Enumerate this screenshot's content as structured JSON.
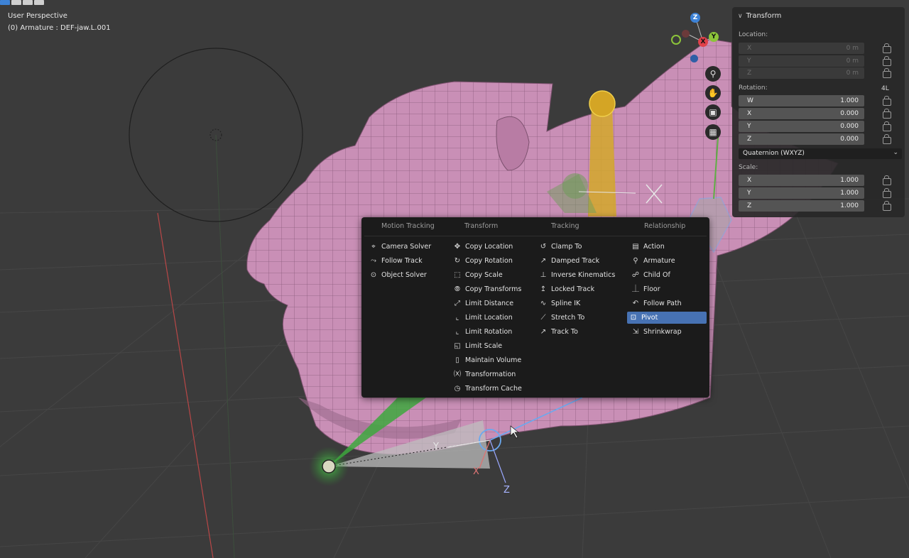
{
  "viewport": {
    "mode_label": "User Perspective",
    "object_label": "(0) Armature : DEF-jaw.L.001",
    "gizmo_axes": {
      "x": "X",
      "y": "Y",
      "z": "Z"
    },
    "bone_axis_labels": {
      "x": "X",
      "y": "Y",
      "z": "Z"
    },
    "nav_tools": [
      "zoom-icon",
      "pan-hand-icon",
      "camera-icon",
      "grid-icon"
    ]
  },
  "transform_panel": {
    "title": "Transform",
    "location_label": "Location:",
    "location": [
      {
        "axis": "X",
        "value": "0 m"
      },
      {
        "axis": "Y",
        "value": "0 m"
      },
      {
        "axis": "Z",
        "value": "0 m"
      }
    ],
    "rotation_label": "Rotation:",
    "rotation_badge": "4L",
    "rotation": [
      {
        "axis": "W",
        "value": "1.000"
      },
      {
        "axis": "X",
        "value": "0.000"
      },
      {
        "axis": "Y",
        "value": "0.000"
      },
      {
        "axis": "Z",
        "value": "0.000"
      }
    ],
    "rotation_mode": "Quaternion (WXYZ)",
    "scale_label": "Scale:",
    "scale": [
      {
        "axis": "X",
        "value": "1.000"
      },
      {
        "axis": "Y",
        "value": "1.000"
      },
      {
        "axis": "Z",
        "value": "1.000"
      }
    ]
  },
  "constraint_menu": {
    "columns": [
      {
        "header": "Motion Tracking",
        "items": [
          {
            "label": "Camera Solver",
            "icon": "camera-solver-icon"
          },
          {
            "label": "Follow Track",
            "icon": "follow-track-icon"
          },
          {
            "label": "Object Solver",
            "icon": "object-solver-icon"
          }
        ]
      },
      {
        "header": "Transform",
        "items": [
          {
            "label": "Copy Location",
            "icon": "copy-location-icon"
          },
          {
            "label": "Copy Rotation",
            "icon": "copy-rotation-icon"
          },
          {
            "label": "Copy Scale",
            "icon": "copy-scale-icon"
          },
          {
            "label": "Copy Transforms",
            "icon": "copy-transforms-icon"
          },
          {
            "label": "Limit Distance",
            "icon": "limit-distance-icon"
          },
          {
            "label": "Limit Location",
            "icon": "limit-location-icon"
          },
          {
            "label": "Limit Rotation",
            "icon": "limit-rotation-icon"
          },
          {
            "label": "Limit Scale",
            "icon": "limit-scale-icon"
          },
          {
            "label": "Maintain Volume",
            "icon": "maintain-volume-icon"
          },
          {
            "label": "Transformation",
            "icon": "transformation-icon"
          },
          {
            "label": "Transform Cache",
            "icon": "transform-cache-icon"
          }
        ]
      },
      {
        "header": "Tracking",
        "items": [
          {
            "label": "Clamp To",
            "icon": "clamp-to-icon"
          },
          {
            "label": "Damped Track",
            "icon": "damped-track-icon"
          },
          {
            "label": "Inverse Kinematics",
            "icon": "inverse-kinematics-icon"
          },
          {
            "label": "Locked Track",
            "icon": "locked-track-icon"
          },
          {
            "label": "Spline IK",
            "icon": "spline-ik-icon"
          },
          {
            "label": "Stretch To",
            "icon": "stretch-to-icon"
          },
          {
            "label": "Track To",
            "icon": "track-to-icon"
          }
        ]
      },
      {
        "header": "Relationship",
        "items": [
          {
            "label": "Action",
            "icon": "action-icon"
          },
          {
            "label": "Armature",
            "icon": "armature-icon"
          },
          {
            "label": "Child Of",
            "icon": "child-of-icon"
          },
          {
            "label": "Floor",
            "icon": "floor-icon"
          },
          {
            "label": "Follow Path",
            "icon": "follow-path-icon"
          },
          {
            "label": "Pivot",
            "icon": "pivot-icon",
            "active": true
          },
          {
            "label": "Shrinkwrap",
            "icon": "shrinkwrap-icon"
          }
        ]
      }
    ]
  },
  "colors": {
    "highlight": "#4772b3",
    "mesh": "#c88db3",
    "gizmo_x": "#e0404a",
    "gizmo_y": "#8cc43a",
    "gizmo_z": "#3d82d6"
  }
}
